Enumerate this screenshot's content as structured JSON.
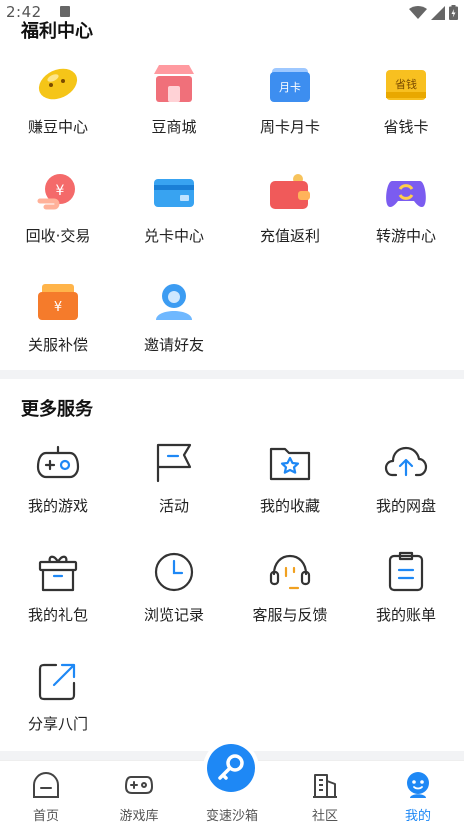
{
  "status": {
    "time": "2:42"
  },
  "welfare": {
    "title": "福利中心",
    "items": [
      {
        "label": "赚豆中心",
        "icon": "bean-icon"
      },
      {
        "label": "豆商城",
        "icon": "shop-icon"
      },
      {
        "label": "周卡月卡",
        "icon": "month-card-icon"
      },
      {
        "label": "省钱卡",
        "icon": "save-card-icon"
      },
      {
        "label": "回收·交易",
        "icon": "recycle-trade-icon"
      },
      {
        "label": "兑卡中心",
        "icon": "redeem-card-icon"
      },
      {
        "label": "充值返利",
        "icon": "wallet-icon"
      },
      {
        "label": "转游中心",
        "icon": "gamepad-transfer-icon"
      },
      {
        "label": "关服补偿",
        "icon": "compensation-icon"
      },
      {
        "label": "邀请好友",
        "icon": "invite-friend-icon"
      }
    ],
    "icon_texts": {
      "month_card": "月卡",
      "save_card": "省钱",
      "yen": "¥"
    }
  },
  "services": {
    "title": "更多服务",
    "items": [
      {
        "label": "我的游戏",
        "icon": "gamepad-icon"
      },
      {
        "label": "活动",
        "icon": "flag-icon"
      },
      {
        "label": "我的收藏",
        "icon": "favorite-folder-icon"
      },
      {
        "label": "我的网盘",
        "icon": "cloud-upload-icon"
      },
      {
        "label": "我的礼包",
        "icon": "gift-icon"
      },
      {
        "label": "浏览记录",
        "icon": "clock-icon"
      },
      {
        "label": "客服与反馈",
        "icon": "headset-icon"
      },
      {
        "label": "我的账单",
        "icon": "bill-icon"
      },
      {
        "label": "分享八门",
        "icon": "share-icon"
      }
    ]
  },
  "tabs": [
    {
      "label": "首页",
      "icon": "home-icon"
    },
    {
      "label": "游戏库",
      "icon": "game-library-icon"
    },
    {
      "label": "变速沙箱",
      "icon": "speed-sandbox-icon"
    },
    {
      "label": "社区",
      "icon": "community-icon"
    },
    {
      "label": "我的",
      "icon": "profile-icon",
      "active": true
    }
  ],
  "colors": {
    "accent": "#1e88f5",
    "text": "#222222",
    "divider": "#f2f3f5"
  }
}
